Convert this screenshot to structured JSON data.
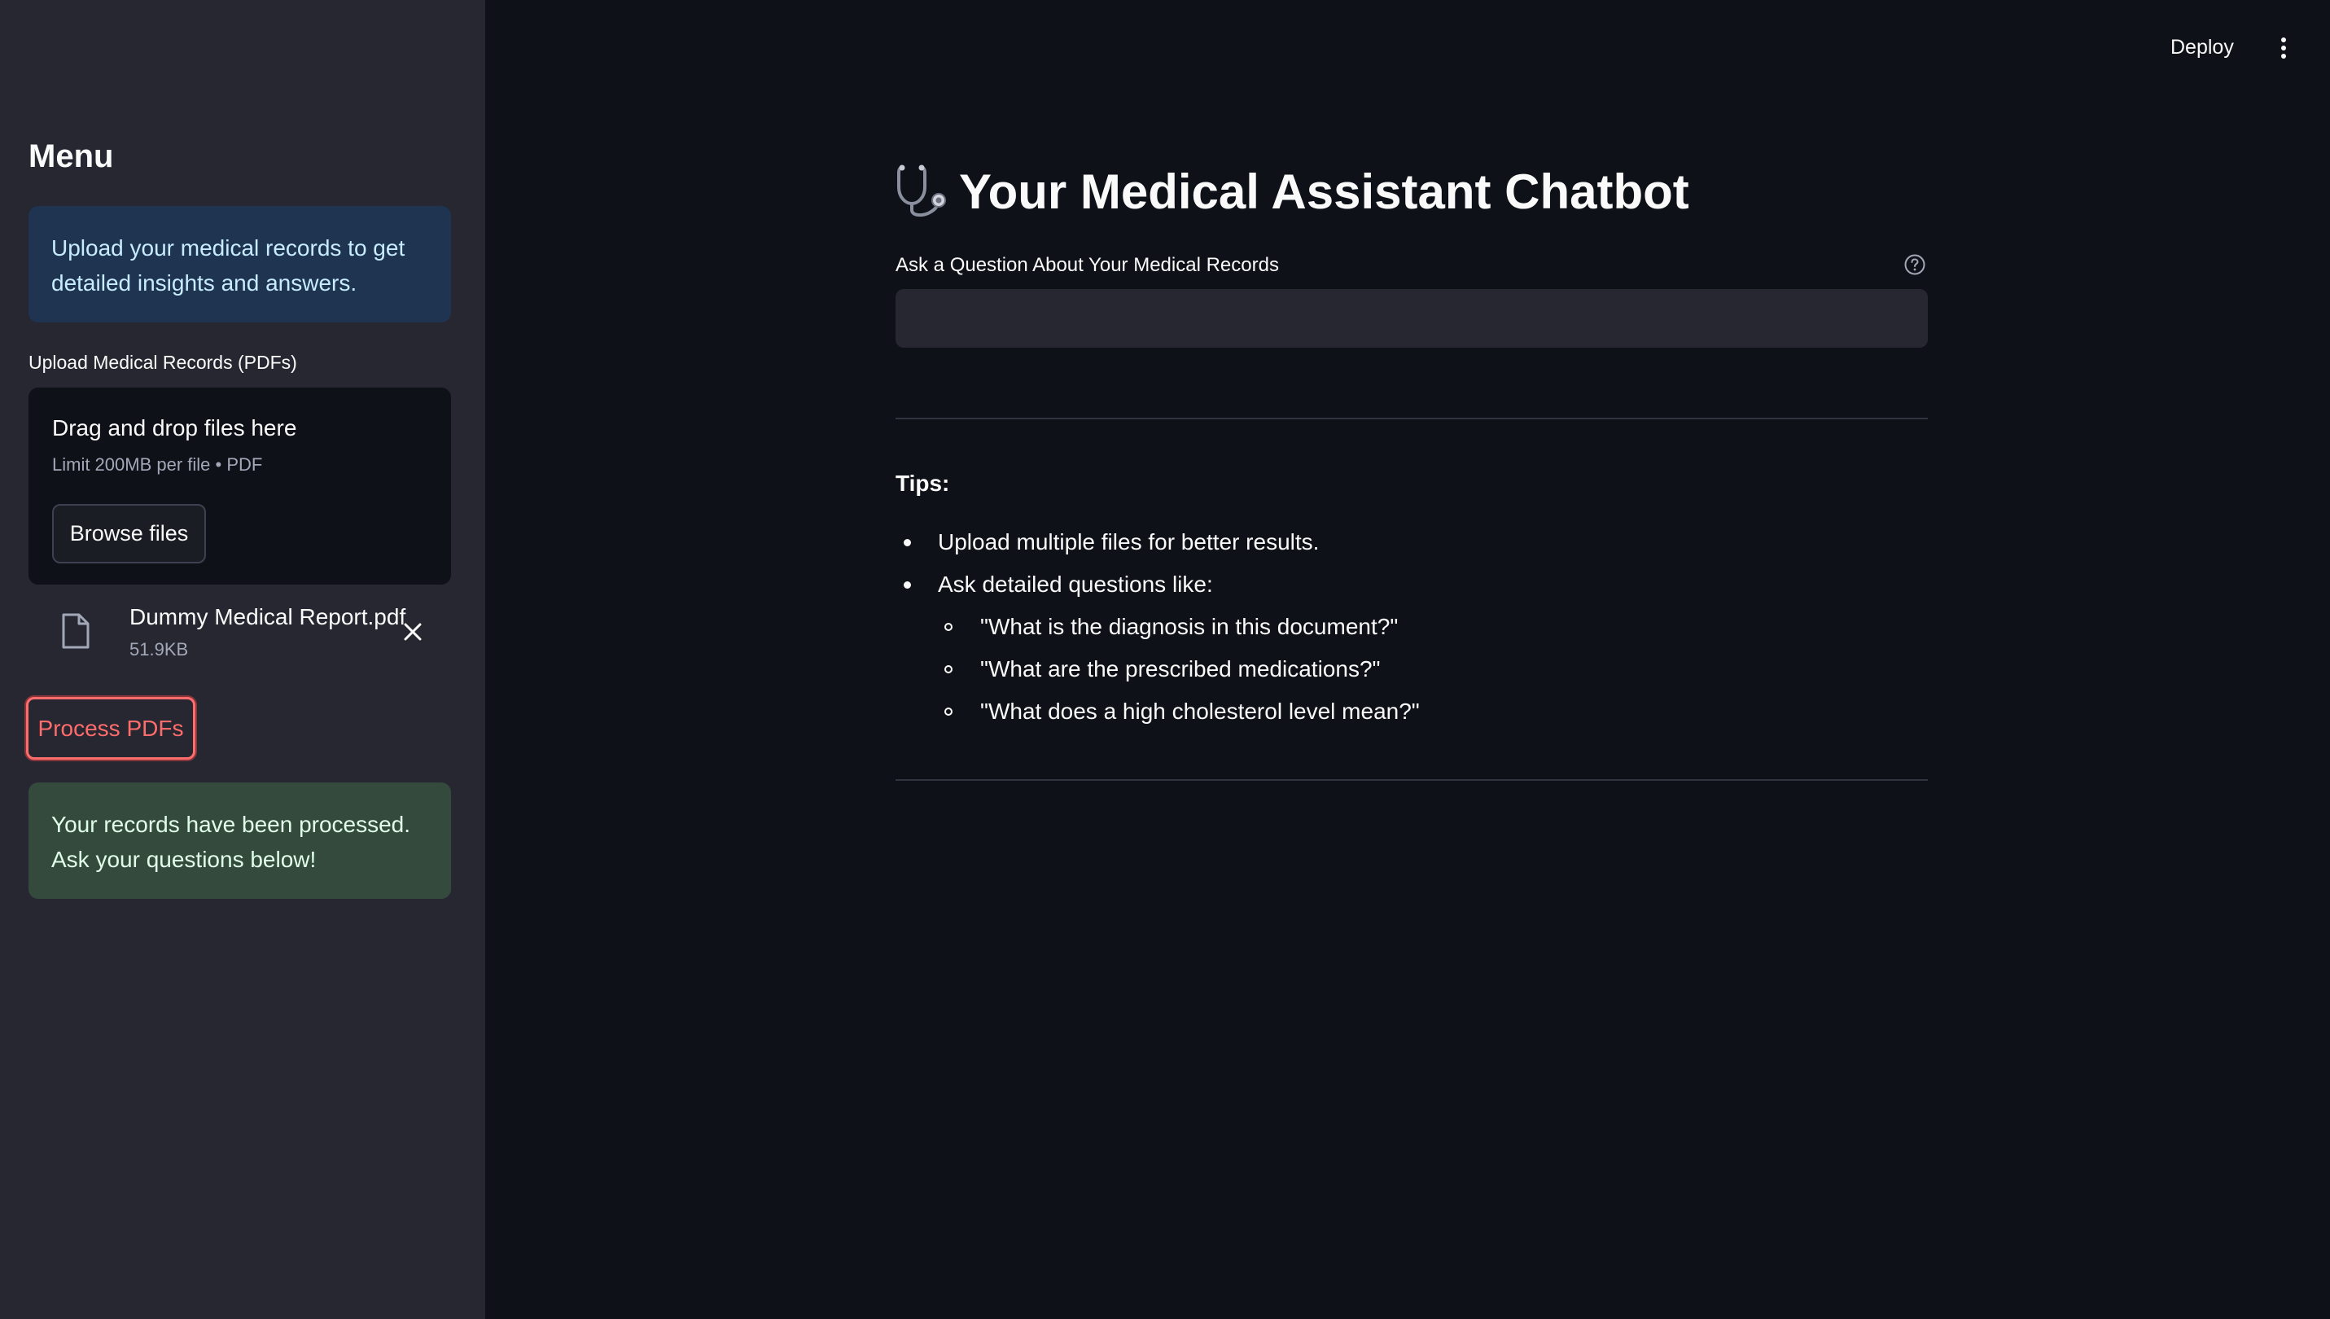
{
  "sidebar": {
    "heading": "Menu",
    "info": "Upload your medical records to get detailed insights and answers.",
    "uploader": {
      "label": "Upload Medical Records (PDFs)",
      "drop_title": "Drag and drop files here",
      "limit": "Limit 200MB per file • PDF",
      "browse_label": "Browse files"
    },
    "file": {
      "icon": "file-icon",
      "name": "Dummy Medical Report.pdf",
      "size": "51.9KB"
    },
    "process_label": "Process PDFs",
    "success_message": "Your records have been processed. Ask your questions below!"
  },
  "topbar": {
    "deploy_label": "Deploy",
    "menu_icon": "vertical-ellipsis-icon"
  },
  "main": {
    "title_icon": "stethoscope-icon",
    "title": "Your Medical Assistant Chatbot",
    "question_label": "Ask a Question About Your Medical Records",
    "question_value": "",
    "tips_heading": "Tips:",
    "tips": [
      "Upload multiple files for better results.",
      "Ask detailed questions like:"
    ],
    "example_questions": [
      "\"What is the diagnosis in this document?\"",
      "\"What are the prescribed medications?\"",
      "\"What does a high cholesterol level mean?\""
    ]
  },
  "colors": {
    "sidebar_bg": "#262730",
    "main_bg": "#0e1117",
    "info_bg": "#1f3450",
    "success_bg": "#344a3d",
    "primary_accent": "#ff4b4b"
  }
}
